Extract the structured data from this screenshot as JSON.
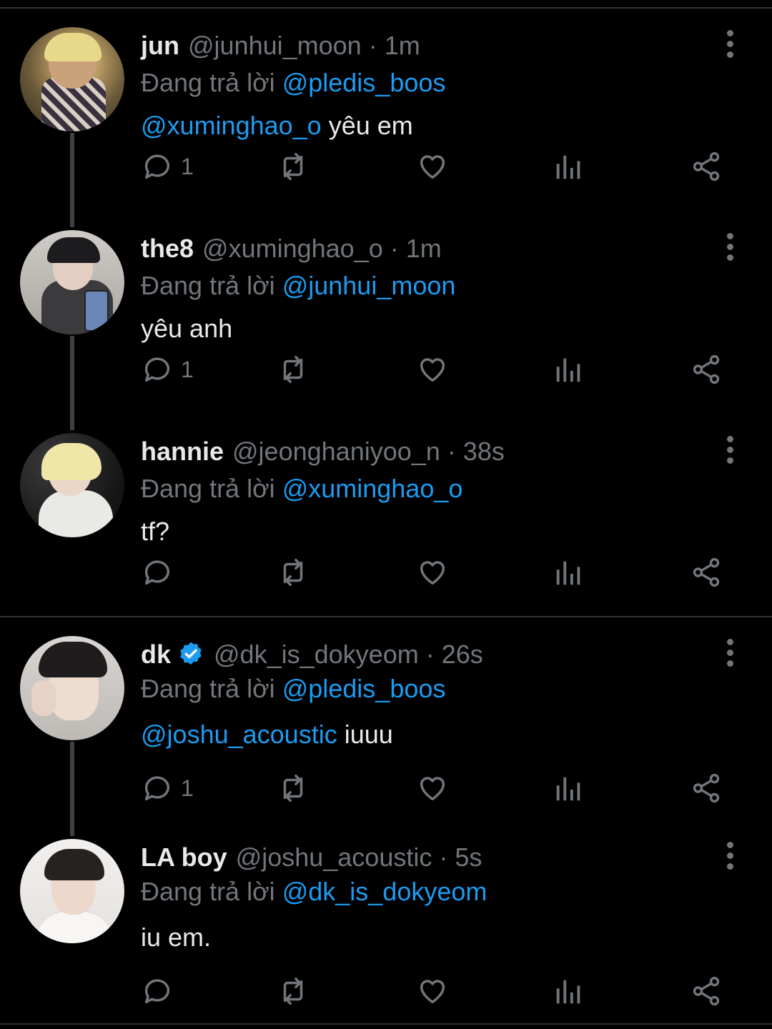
{
  "replying_prefix": "Đang trả lời",
  "colors": {
    "background": "#000000",
    "text": "#e7e9ea",
    "secondary": "#71767b",
    "link": "#1d9bf0",
    "divider": "#2f3336"
  },
  "tweets": [
    {
      "name": "jun",
      "handle": "@junhui_moon",
      "time": "1m",
      "replying_to": "@pledis_boos",
      "body_mention": "@xuminghao_o",
      "body_text": "yêu em",
      "reply_count": "1",
      "verified": false
    },
    {
      "name": "the8",
      "handle": "@xuminghao_o",
      "time": "1m",
      "replying_to": "@junhui_moon",
      "body_mention": "",
      "body_text": "yêu anh",
      "reply_count": "1",
      "verified": false
    },
    {
      "name": "hannie",
      "handle": "@jeonghaniyoo_n",
      "time": "38s",
      "replying_to": "@xuminghao_o",
      "body_mention": "",
      "body_text": "tf?",
      "reply_count": "",
      "verified": false
    },
    {
      "name": "dk",
      "handle": "@dk_is_dokyeom",
      "time": "26s",
      "replying_to": "@pledis_boos",
      "body_mention": "@joshu_acoustic",
      "body_text": "iuuu",
      "reply_count": "1",
      "verified": true
    },
    {
      "name": "LA boy",
      "handle": "@joshu_acoustic",
      "time": "5s",
      "replying_to": "@dk_is_dokyeom",
      "body_mention": "",
      "body_text": "iu em.",
      "reply_count": "",
      "verified": false
    }
  ],
  "icons": [
    "reply-icon",
    "retweet-icon",
    "like-icon",
    "analytics-icon",
    "share-icon",
    "more-options-icon",
    "verified-badge-icon"
  ]
}
